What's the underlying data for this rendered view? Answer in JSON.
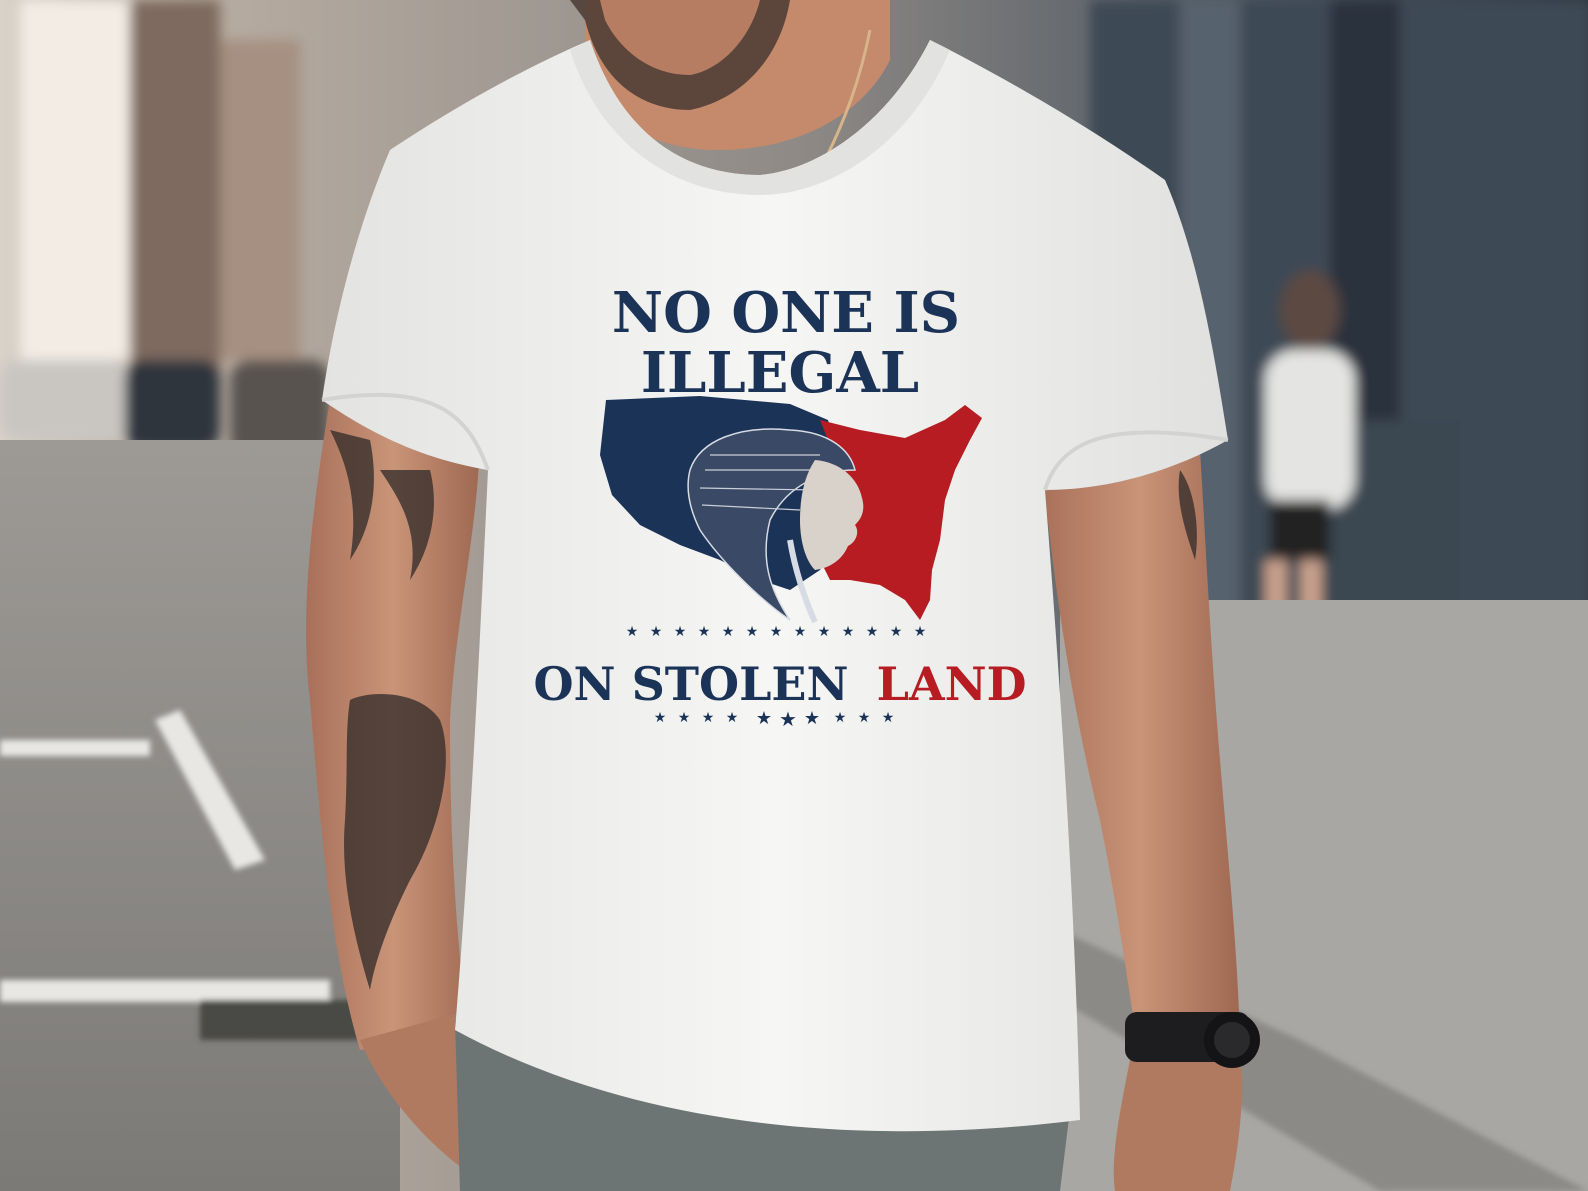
{
  "print": {
    "line1": "NO ONE IS",
    "line2": "ILLEGAL",
    "line3_part1": "ON STOLEN",
    "line3_part2": "LAND"
  },
  "colors": {
    "navy": "#1c3358",
    "red": "#b71c22",
    "shirt": "#f3f3f1",
    "skin": "#c48a6b",
    "street": "#a9a7a3"
  }
}
